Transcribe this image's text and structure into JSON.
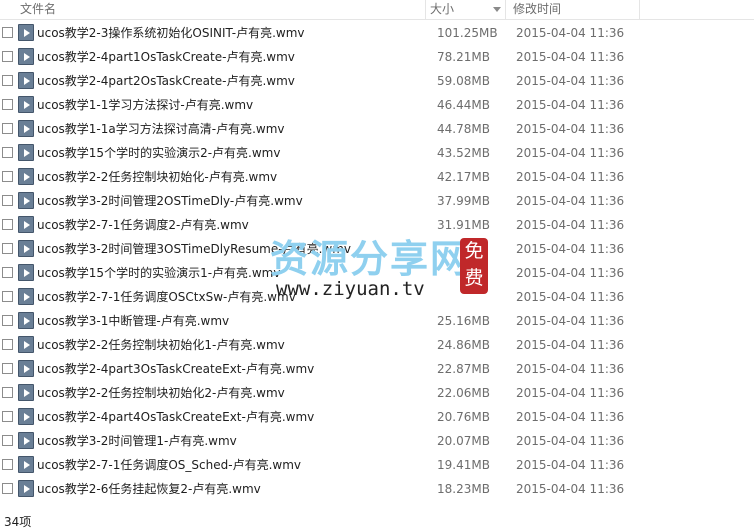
{
  "header": {
    "name_label": "文件名",
    "size_label": "大小",
    "date_label": "修改时间"
  },
  "files": [
    {
      "name": "ucos教学2-3操作系统初始化OSINIT-卢有亮.wmv",
      "size": "101.25MB",
      "date": "2015-04-04 11:36"
    },
    {
      "name": "ucos教学2-4part1OsTaskCreate-卢有亮.wmv",
      "size": "78.21MB",
      "date": "2015-04-04 11:36"
    },
    {
      "name": "ucos教学2-4part2OsTaskCreate-卢有亮.wmv",
      "size": "59.08MB",
      "date": "2015-04-04 11:36"
    },
    {
      "name": "ucos教学1-1学习方法探讨-卢有亮.wmv",
      "size": "46.44MB",
      "date": "2015-04-04 11:36"
    },
    {
      "name": "ucos教学1-1a学习方法探讨高清-卢有亮.wmv",
      "size": "44.78MB",
      "date": "2015-04-04 11:36"
    },
    {
      "name": "ucos教学15个学时的实验演示2-卢有亮.wmv",
      "size": "43.52MB",
      "date": "2015-04-04 11:36"
    },
    {
      "name": "ucos教学2-2任务控制块初始化-卢有亮.wmv",
      "size": "42.17MB",
      "date": "2015-04-04 11:36"
    },
    {
      "name": "ucos教学3-2时间管理2OSTimeDly-卢有亮.wmv",
      "size": "37.99MB",
      "date": "2015-04-04 11:36"
    },
    {
      "name": "ucos教学2-7-1任务调度2-卢有亮.wmv",
      "size": "31.91MB",
      "date": "2015-04-04 11:36"
    },
    {
      "name": "ucos教学3-2时间管理3OSTimeDlyResume-卢有亮.wmv",
      "size": "",
      "date": "2015-04-04 11:36"
    },
    {
      "name": "ucos教学15个学时的实验演示1-卢有亮.wmv",
      "size": "",
      "date": "2015-04-04 11:36"
    },
    {
      "name": "ucos教学2-7-1任务调度OSCtxSw-卢有亮.wmv",
      "size": "",
      "date": "2015-04-04 11:36"
    },
    {
      "name": "ucos教学3-1中断管理-卢有亮.wmv",
      "size": "25.16MB",
      "date": "2015-04-04 11:36"
    },
    {
      "name": "ucos教学2-2任务控制块初始化1-卢有亮.wmv",
      "size": "24.86MB",
      "date": "2015-04-04 11:36"
    },
    {
      "name": "ucos教学2-4part3OsTaskCreateExt-卢有亮.wmv",
      "size": "22.87MB",
      "date": "2015-04-04 11:36"
    },
    {
      "name": "ucos教学2-2任务控制块初始化2-卢有亮.wmv",
      "size": "22.06MB",
      "date": "2015-04-04 11:36"
    },
    {
      "name": "ucos教学2-4part4OsTaskCreateExt-卢有亮.wmv",
      "size": "20.76MB",
      "date": "2015-04-04 11:36"
    },
    {
      "name": "ucos教学3-2时间管理1-卢有亮.wmv",
      "size": "20.07MB",
      "date": "2015-04-04 11:36"
    },
    {
      "name": "ucos教学2-7-1任务调度OS_Sched-卢有亮.wmv",
      "size": "19.41MB",
      "date": "2015-04-04 11:36"
    },
    {
      "name": "ucos教学2-6任务挂起恢复2-卢有亮.wmv",
      "size": "18.23MB",
      "date": "2015-04-04 11:36"
    }
  ],
  "status": {
    "item_count": "34项"
  },
  "watermark": {
    "cn_text": "资源分享网",
    "seal_text": "免费",
    "en_text": "www.ziyuan.tv"
  },
  "colors": {
    "watermark_cn": "#8fd0ef",
    "seal": "#c0282a",
    "header_text": "#6d6d6d"
  }
}
